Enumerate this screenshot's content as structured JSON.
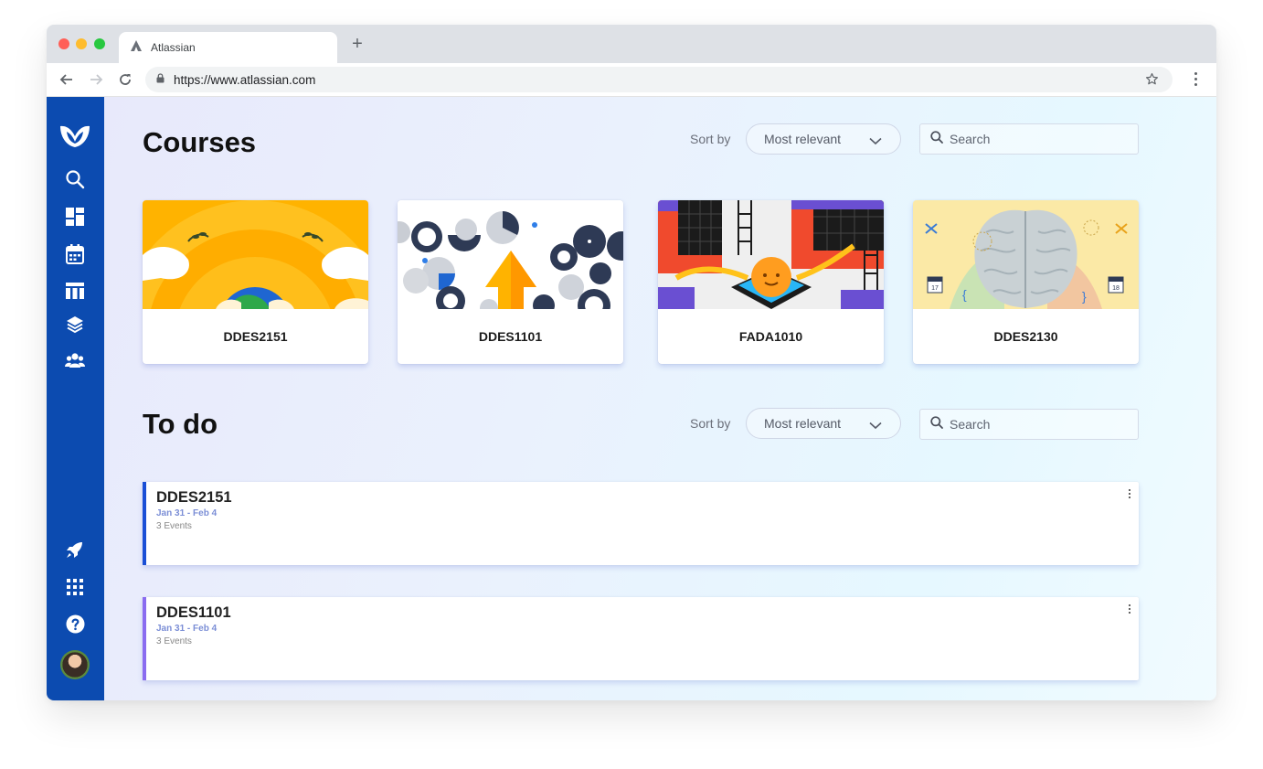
{
  "browser": {
    "tab_title": "Atlassian",
    "new_tab_symbol": "+",
    "url": "https://www.atlassian.com",
    "icons": [
      "atlassian-icon",
      "back-icon",
      "forward-icon",
      "reload-icon",
      "lock-icon",
      "star-icon",
      "menu-icon"
    ]
  },
  "sidebar": {
    "items": [
      {
        "icon": "logo-icon"
      },
      {
        "icon": "search-icon"
      },
      {
        "icon": "dashboard-icon"
      },
      {
        "icon": "calendar-icon"
      },
      {
        "icon": "board-icon"
      },
      {
        "icon": "layers-icon"
      },
      {
        "icon": "people-icon"
      },
      {
        "icon": "rocket-icon"
      },
      {
        "icon": "apps-grid-icon"
      },
      {
        "icon": "help-icon"
      },
      {
        "icon": "avatar"
      }
    ],
    "color": "#0c4bb0"
  },
  "courses": {
    "title": "Courses",
    "sort_label": "Sort by",
    "sort_value": "Most relevant",
    "search_placeholder": "Search",
    "cards": [
      {
        "code": "DDES2151"
      },
      {
        "code": "DDES1101"
      },
      {
        "code": "FADA1010"
      },
      {
        "code": "DDES2130"
      }
    ]
  },
  "todo": {
    "title": "To do",
    "sort_label": "Sort by",
    "sort_value": "Most relevant",
    "search_placeholder": "Search",
    "items": [
      {
        "title": "DDES2151",
        "dates": "Jan 31 - Feb 4",
        "events": "3 Events",
        "accent": "#1a4fd6"
      },
      {
        "title": "DDES1101",
        "dates": "Jan 31 - Feb 4",
        "events": "3 Events",
        "accent": "#8a6cf0"
      }
    ]
  }
}
